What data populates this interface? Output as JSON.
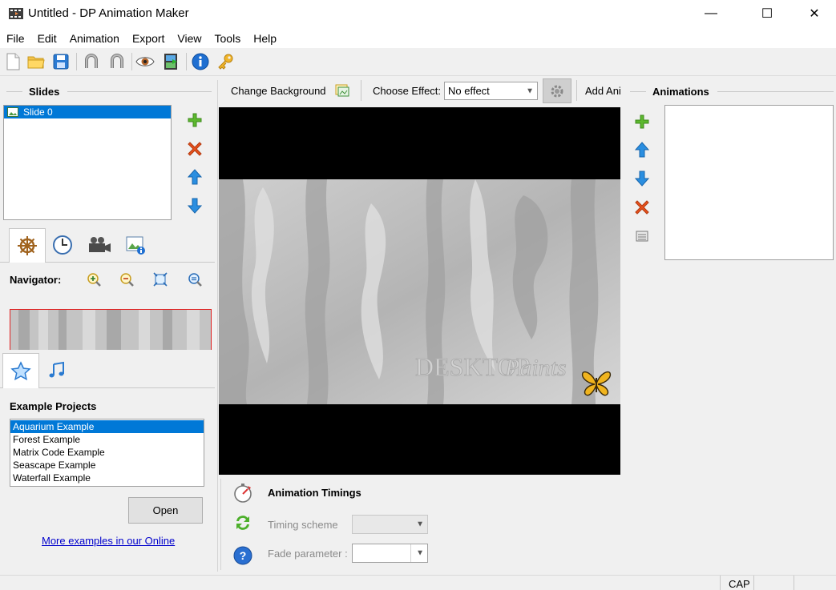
{
  "window": {
    "title": "Untitled - DP Animation Maker",
    "minimize_glyph": "—",
    "maximize_glyph": "☐",
    "close_glyph": "✕"
  },
  "menu": [
    "File",
    "Edit",
    "Animation",
    "Export",
    "View",
    "Tools",
    "Help"
  ],
  "toolbar": {
    "icons": [
      "new-file-icon",
      "open-folder-icon",
      "save-icon",
      "undo-icon",
      "redo-icon",
      "preview-eye-icon",
      "export-film-icon",
      "info-icon",
      "key-icon"
    ]
  },
  "slides": {
    "header": "Slides",
    "items": [
      {
        "label": "Slide 0",
        "selected": true
      }
    ]
  },
  "slide_buttons": [
    "add-icon",
    "delete-icon",
    "move-up-icon",
    "move-down-icon"
  ],
  "tabs_top": [
    "helm-wheel-icon",
    "clock-icon",
    "camera-icon",
    "image-info-icon"
  ],
  "navigator": {
    "label": "Navigator:",
    "buttons": [
      "zoom-in-icon",
      "zoom-out-icon",
      "fit-icon",
      "zoom-actual-icon"
    ]
  },
  "tabs_bottom": [
    "star-icon",
    "music-note-icon"
  ],
  "examples": {
    "header": "Example Projects",
    "items": [
      {
        "label": "Aquarium Example",
        "selected": true
      },
      {
        "label": "Forest Example",
        "selected": false
      },
      {
        "label": "Matrix Code Example",
        "selected": false
      },
      {
        "label": "Seascape Example",
        "selected": false
      },
      {
        "label": "Waterfall Example",
        "selected": false
      }
    ],
    "open_label": "Open",
    "more_link": "More examples in our Online"
  },
  "canvas_toolbar": {
    "change_background": "Change Background",
    "choose_effect_label": "Choose Effect:",
    "effect_value": "No effect",
    "add_animation": "Add Ani"
  },
  "canvas": {
    "watermark_text_1": "DESKTOP",
    "watermark_text_2": "Paints"
  },
  "timings": {
    "header": "Animation Timings",
    "timing_scheme_label": "Timing scheme",
    "fade_parameter_label": "Fade parameter :"
  },
  "animations": {
    "header": "Animations",
    "buttons": [
      "add-icon",
      "move-up-icon",
      "move-down-icon",
      "delete-icon",
      "properties-icon"
    ]
  },
  "status": {
    "cap": "CAP"
  },
  "colors": {
    "selection": "#0078d7",
    "add_green": "#5cb82e",
    "delete_red": "#e8501c",
    "arrow_blue": "#2a8ee0"
  }
}
